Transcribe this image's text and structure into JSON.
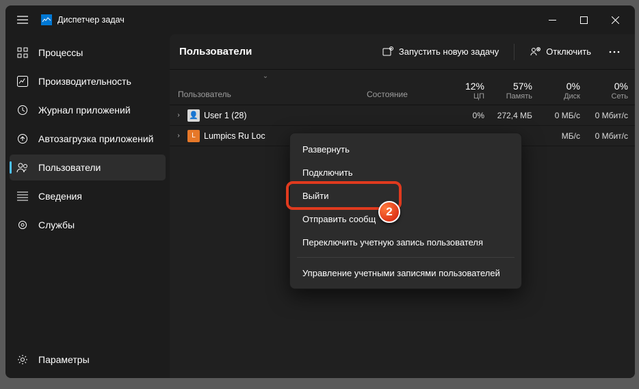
{
  "title": "Диспетчер задач",
  "sidebar": {
    "items": [
      {
        "label": "Процессы"
      },
      {
        "label": "Производительность"
      },
      {
        "label": "Журнал приложений"
      },
      {
        "label": "Автозагрузка приложений"
      },
      {
        "label": "Пользователи"
      },
      {
        "label": "Сведения"
      },
      {
        "label": "Службы"
      }
    ],
    "settings": "Параметры"
  },
  "page": {
    "title": "Пользователи",
    "run_task": "Запустить новую задачу",
    "disconnect": "Отключить"
  },
  "columns": {
    "user": "Пользователь",
    "state": "Состояние",
    "cpu": {
      "pct": "12%",
      "lbl": "ЦП"
    },
    "mem": {
      "pct": "57%",
      "lbl": "Память"
    },
    "disk": {
      "pct": "0%",
      "lbl": "Диск"
    },
    "net": {
      "pct": "0%",
      "lbl": "Сеть"
    }
  },
  "rows": [
    {
      "name": "User 1 (28)",
      "state": "",
      "cpu": "0%",
      "mem": "272,4 МБ",
      "disk": "0 МБ/с",
      "net": "0 Мбит/с"
    },
    {
      "name": "Lumpics Ru Loc",
      "state": "",
      "cpu": "",
      "mem": "",
      "disk": "МБ/с",
      "net": "0 Мбит/с"
    }
  ],
  "ctx": {
    "expand": "Развернуть",
    "connect": "Подключить",
    "signout": "Выйти",
    "sendmsg": "Отправить сообщ",
    "switch": "Переключить учетную запись пользователя",
    "manage": "Управление учетными записями пользователей"
  },
  "badge": "2"
}
